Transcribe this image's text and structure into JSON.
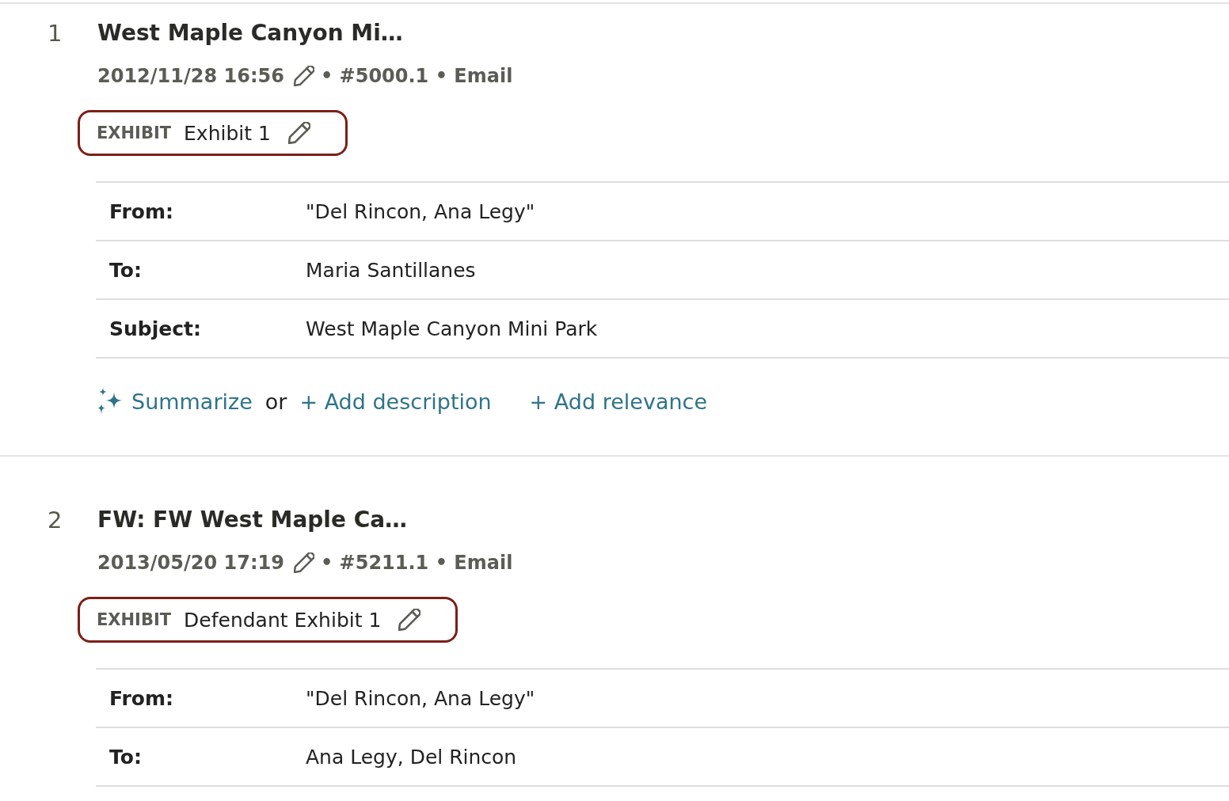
{
  "documents": [
    {
      "number": "1",
      "title": "West Maple Canyon Mi…",
      "date": "2012/11/28 16:56",
      "details": "• #5000.1 • Email",
      "exhibit": {
        "label": "EXHIBIT",
        "value": "Exhibit 1"
      },
      "fields": [
        {
          "label": "From:",
          "value": "\"Del Rincon, Ana Legy\""
        },
        {
          "label": "To:",
          "value": "Maria Santillanes"
        },
        {
          "label": "Subject:",
          "value": "West Maple Canyon Mini Park"
        }
      ],
      "actions": {
        "summarize": "Summarize",
        "joiner": "or",
        "add_description": "+ Add description",
        "add_relevance": "+ Add relevance"
      }
    },
    {
      "number": "2",
      "title": "FW: FW West Maple Ca…",
      "date": "2013/05/20 17:19",
      "details": "• #5211.1 • Email",
      "exhibit": {
        "label": "EXHIBIT",
        "value": "Defendant Exhibit 1"
      },
      "fields": [
        {
          "label": "From:",
          "value": "\"Del Rincon, Ana Legy\""
        },
        {
          "label": "To:",
          "value": "Ana Legy, Del Rincon"
        }
      ]
    }
  ]
}
